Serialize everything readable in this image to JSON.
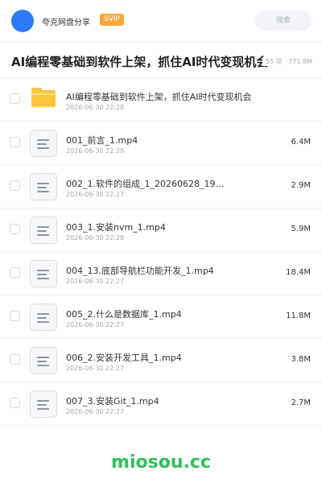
{
  "header": {
    "username": "夸克网盘分享",
    "badge": "SVIP",
    "search_placeholder": "搜索"
  },
  "folder": {
    "title": "AI编程零基础到软件上架，抓住AI时代变现机会",
    "meta": "55 项 · 771.8M"
  },
  "items": [
    {
      "type": "folder",
      "name": "AI编程零基础到软件上架，抓住AI时代变现机会",
      "date": "2026-06-30 22:28",
      "size": ""
    },
    {
      "type": "file",
      "name": "001_前言_1.mp4",
      "date": "2026-06-30 22:28",
      "size": "6.4M"
    },
    {
      "type": "file",
      "name": "002_1.软件的组成_1_20260628_19…",
      "date": "2026-06-30 22:27",
      "size": "2.9M"
    },
    {
      "type": "file",
      "name": "003_1.安装nvm_1.mp4",
      "date": "2026-06-30 22:28",
      "size": "5.9M"
    },
    {
      "type": "file",
      "name": "004_13.底部导航栏功能开发_1.mp4",
      "date": "2026-06-30 22:27",
      "size": "18.4M"
    },
    {
      "type": "file",
      "name": "005_2.什么是数据库_1.mp4",
      "date": "2026-06-30 22:27",
      "size": "11.8M"
    },
    {
      "type": "file",
      "name": "006_2.安装开发工具_1.mp4",
      "date": "2026-06-30 22:27",
      "size": "3.8M"
    },
    {
      "type": "file",
      "name": "007_3.安装Git_1.mp4",
      "date": "2026-06-30 22:27",
      "size": "2.7M"
    }
  ],
  "watermark": "miosou.cc",
  "colors": {
    "avatar": "#2f7bf5",
    "badge": "#f7a93a",
    "folder_icon": "#fbc83a",
    "watermark": "#2fbf5b"
  }
}
